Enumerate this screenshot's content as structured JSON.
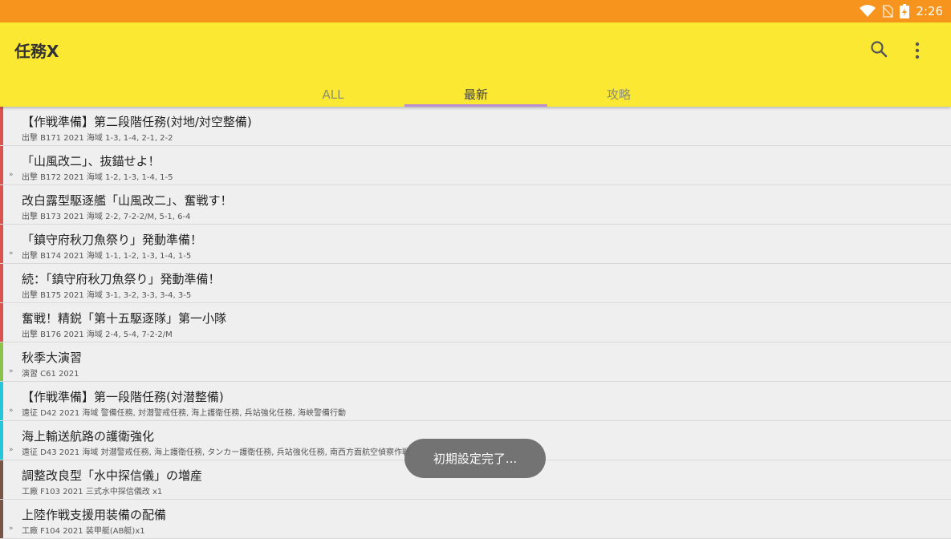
{
  "status_bar": {
    "time": "2:26",
    "icons": [
      "wifi-icon",
      "no-sim-icon",
      "battery-charging-icon"
    ],
    "color": "#f7941d"
  },
  "app_bar": {
    "title": "任務X",
    "color": "#fbe833",
    "actions": [
      "search-icon",
      "more-vert-icon"
    ]
  },
  "tabs": [
    {
      "label": "ALL",
      "active": false
    },
    {
      "label": "最新",
      "active": true
    },
    {
      "label": "攻略",
      "active": false
    }
  ],
  "accent": "#b98fd1",
  "categories": {
    "sortie": "#d9534f",
    "exercise": "#8bc34a",
    "expedition": "#26c6da",
    "arsenal": "#795548"
  },
  "quests": [
    {
      "title": "【作戦準備】第二段階任務(対地/対空整備)",
      "subtitle": "出撃 B171 2021 海域 1-3, 1-4, 2-1, 2-2",
      "category": "sortie",
      "chevron": false
    },
    {
      "title": "「山風改二」、抜錨せよ！",
      "subtitle": "出撃 B172 2021 海域 1-2, 1-3, 1-4, 1-5",
      "category": "sortie",
      "chevron": true
    },
    {
      "title": "改白露型駆逐艦「山風改二」、奮戦す！",
      "subtitle": "出撃 B173 2021 海域 2-2, 7-2-2/M, 5-1, 6-4",
      "category": "sortie",
      "chevron": false
    },
    {
      "title": "「鎮守府秋刀魚祭り」発動準備！",
      "subtitle": "出撃 B174 2021 海域 1-1, 1-2, 1-3, 1-4, 1-5",
      "category": "sortie",
      "chevron": true
    },
    {
      "title": "続：「鎮守府秋刀魚祭り」発動準備！",
      "subtitle": "出撃 B175 2021 海域 3-1, 3-2, 3-3, 3-4, 3-5",
      "category": "sortie",
      "chevron": false
    },
    {
      "title": "奮戦！精鋭「第十五駆逐隊」第一小隊",
      "subtitle": "出撃 B176 2021 海域 2-4, 5-4, 7-2-2/M",
      "category": "sortie",
      "chevron": false
    },
    {
      "title": "秋季大演習",
      "subtitle": "演習 C61 2021",
      "category": "exercise",
      "chevron": true
    },
    {
      "title": "【作戦準備】第一段階任務(対潜整備)",
      "subtitle": "遠征 D42 2021 海域 警備任務, 対潜警戒任務, 海上護衛任務, 兵站強化任務, 海峡警備行動",
      "category": "expedition",
      "chevron": true
    },
    {
      "title": "海上輸送航路の護衛強化",
      "subtitle": "遠征 D43 2021 海域 対潜警戒任務, 海上護衛任務, タンカー護衛任務, 兵站強化任務, 南西方面航空偵察作戦",
      "category": "expedition",
      "chevron": true
    },
    {
      "title": "調整改良型「水中探信儀」の増産",
      "subtitle": "工廠 F103 2021 三式水中探信儀改 x1",
      "category": "arsenal",
      "chevron": false
    },
    {
      "title": "上陸作戦支援用装備の配備",
      "subtitle": "工廠 F104 2021 装甲艇(AB艇)x1",
      "category": "arsenal",
      "chevron": true
    }
  ],
  "toast": {
    "text": "初期設定完了..."
  },
  "chevron_glyph": "»"
}
